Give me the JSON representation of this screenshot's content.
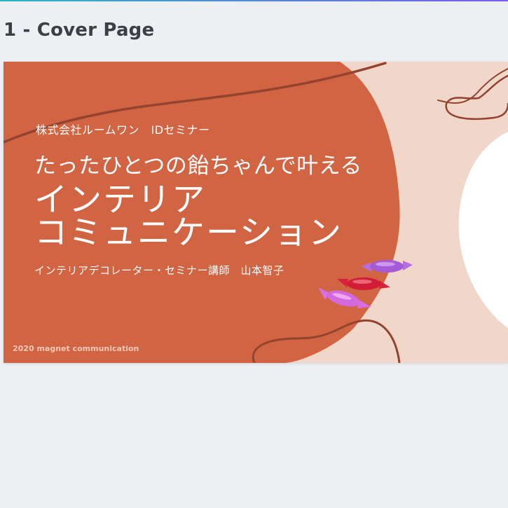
{
  "page": {
    "heading": "1 - Cover Page"
  },
  "slide": {
    "company_line": "株式会社ルームワン　IDセミナー",
    "subtitle": "たったひとつの飴ちゃんで叶える",
    "title_line1": "インテリア",
    "title_line2": "コミュニケーション",
    "presenter": "インテリアデコレーター・セミナー講師　山本智子",
    "footer": "2020 magnet communication"
  },
  "colors": {
    "background": "#edf0f3",
    "heading_text": "#3b4047",
    "slide_orange": "#d06443",
    "slide_pink": "#f1d6ca",
    "stroke_brown": "#93432e",
    "candy_purple": "#a65ad6",
    "candy_red": "#d9223c",
    "candy_pink": "#d86fe0"
  },
  "icons": [
    "candy-purple-icon",
    "candy-red-icon",
    "candy-pink-icon"
  ]
}
